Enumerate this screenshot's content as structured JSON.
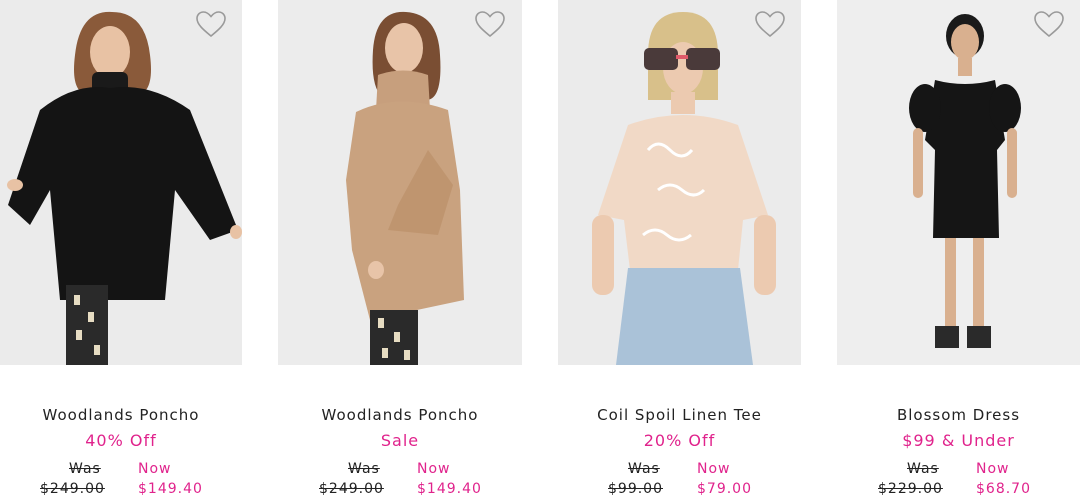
{
  "colors": {
    "accent": "#e0238c",
    "text": "#222222",
    "image_bg": "#ececec"
  },
  "icons": {
    "wishlist": "heart-outline-icon"
  },
  "products": [
    {
      "name": "Woodlands Poncho",
      "promo": "40% Off",
      "was_label": "Was",
      "was_price": "$249.00",
      "now_label": "Now",
      "now_price": "$149.40",
      "image": "model in black knit turtleneck poncho"
    },
    {
      "name": "Woodlands Poncho",
      "promo": "Sale",
      "was_label": "Was",
      "was_price": "$249.00",
      "now_label": "Now",
      "now_price": "$149.40",
      "image": "model in camel knit turtleneck poncho"
    },
    {
      "name": "Coil Spoil Linen Tee",
      "promo": "20% Off",
      "was_label": "Was",
      "was_price": "$99.00",
      "now_label": "Now",
      "now_price": "$79.00",
      "image": "model in printed linen tee and light jeans"
    },
    {
      "name": "Blossom Dress",
      "promo": "$99 & Under",
      "was_label": "Was",
      "was_price": "$229.00",
      "now_label": "Now",
      "now_price": "$68.70",
      "image": "model in black puff sleeve dress"
    }
  ]
}
